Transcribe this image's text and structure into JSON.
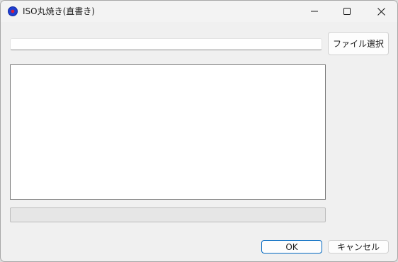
{
  "window": {
    "title": "ISO丸焼き(直書き)",
    "icon": "iso-disc-icon"
  },
  "controls": {
    "minimize": "minimize-icon",
    "maximize": "maximize-icon",
    "close": "close-icon"
  },
  "file_row": {
    "path_value": "",
    "select_button_label": "ファイル選択"
  },
  "log": {
    "text": ""
  },
  "progress": {
    "value": 0
  },
  "footer": {
    "ok_label": "OK",
    "cancel_label": "キャンセル"
  },
  "colors": {
    "window_bg": "#f0f0f0",
    "accent": "#0067c0",
    "icon_outer": "#1f3fd1",
    "icon_inner": "#d81e3a"
  }
}
